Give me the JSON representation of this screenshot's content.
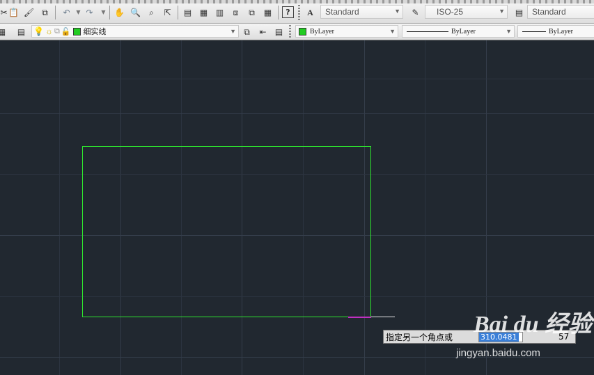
{
  "toolbar_top": {
    "text_style": "Standard",
    "dim_style": "ISO-25",
    "table_style": "Standard"
  },
  "layer_toolbar": {
    "layer_name": "细实线",
    "layer_color": "#22cc22",
    "color": "ByLayer",
    "color_swatch": "#22cc22",
    "linetype": "ByLayer",
    "lineweight": "ByLayer"
  },
  "canvas": {
    "background": "#212830",
    "rectangle_color": "#2ee62e"
  },
  "command_prompt": {
    "text": "指定另一个角点或",
    "input_value": "310.0481",
    "tail_value": "57"
  },
  "watermark": {
    "logo_text": "Bai du 经验",
    "url": "jingyan.baidu.com"
  }
}
